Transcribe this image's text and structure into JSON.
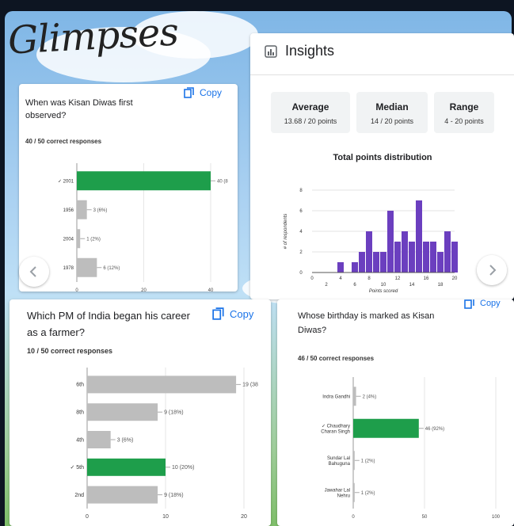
{
  "title": "Glimpses",
  "nav": {
    "prev_icon": "chevron-left-icon",
    "next_icon": "chevron-right-icon"
  },
  "card1": {
    "question": "When was Kisan Diwas first observed?",
    "correct_responses": "40 / 50 correct responses",
    "copy_label": "Copy"
  },
  "insights": {
    "title": "Insights",
    "stats": [
      {
        "label": "Average",
        "value": "13.68 / 20 points"
      },
      {
        "label": "Median",
        "value": "14 / 20 points"
      },
      {
        "label": "Range",
        "value": "4 - 20 points"
      }
    ]
  },
  "card2": {
    "question": "Which PM of India began his career as a farmer?",
    "correct_responses": "10 / 50 correct responses",
    "copy_label": "Copy"
  },
  "card3": {
    "question": "Whose birthday is marked as Kisan Diwas?",
    "correct_responses": "46 / 50 correct responses",
    "copy_label": "Copy"
  },
  "colors": {
    "correct": "#1e9e4b",
    "incorrect": "#bdbdbd",
    "histogram": "#6b3fbf",
    "accent": "#1a73e8"
  },
  "chart_data": [
    {
      "type": "bar",
      "orientation": "horizontal",
      "categories": [
        "✓ 2001",
        "1956",
        "2004",
        "1978"
      ],
      "values": [
        40,
        3,
        1,
        6
      ],
      "labels": [
        "40 (8",
        "3 (6%)",
        "1 (2%)",
        "6 (12%)"
      ],
      "correct_index": 0,
      "xticks": [
        0,
        20,
        40
      ],
      "xlim": [
        0,
        40
      ]
    },
    {
      "type": "bar",
      "title": "Total points distribution",
      "xlabel": "Points scored",
      "ylabel": "# of respondents",
      "x": [
        4,
        6,
        7,
        8,
        9,
        10,
        11,
        12,
        13,
        14,
        15,
        16,
        17,
        18,
        19,
        20
      ],
      "values": [
        1,
        1,
        2,
        4,
        2,
        2,
        6,
        3,
        4,
        3,
        7,
        3,
        3,
        2,
        4,
        3
      ],
      "xticks_top": [
        0,
        4,
        8,
        12,
        16,
        20
      ],
      "xticks_bottom": [
        2,
        6,
        10,
        14,
        18
      ],
      "yticks": [
        0,
        2,
        4,
        6,
        8
      ],
      "xlim": [
        0,
        20
      ],
      "ylim": [
        0,
        8
      ],
      "grid": true
    },
    {
      "type": "bar",
      "orientation": "horizontal",
      "categories": [
        "6th",
        "8th",
        "4th",
        "✓ 5th",
        "2nd"
      ],
      "values": [
        19,
        9,
        3,
        10,
        9
      ],
      "labels": [
        "19 (38",
        "9 (18%)",
        "3 (6%)",
        "10 (20%)",
        "9 (18%)"
      ],
      "correct_index": 3,
      "xticks": [
        0,
        10,
        20
      ],
      "xlim": [
        0,
        20
      ]
    },
    {
      "type": "bar",
      "orientation": "horizontal",
      "categories": [
        "Indra Gandhi",
        "✓ Chaudhary Charan Singh",
        "Sundar Lal Bahuguna",
        "Jawahar Lal Nehru"
      ],
      "values": [
        2,
        46,
        1,
        1
      ],
      "labels": [
        "2 (4%)",
        "46 (92%)",
        "1 (2%)",
        "1 (2%)"
      ],
      "correct_index": 1,
      "xticks": [
        0,
        50,
        100
      ],
      "xlim": [
        0,
        100
      ]
    }
  ]
}
